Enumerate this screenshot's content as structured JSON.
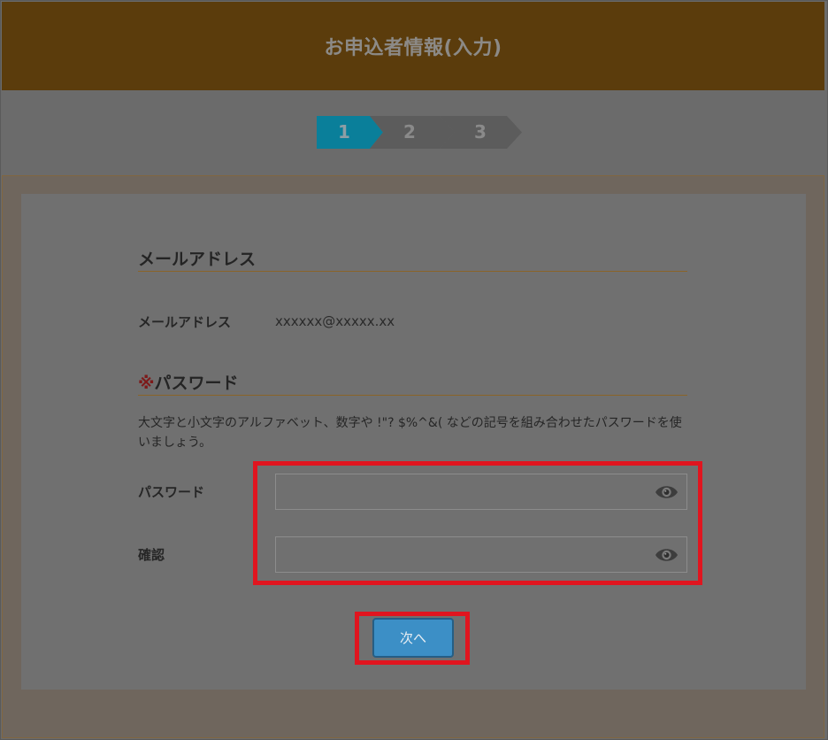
{
  "header": {
    "title": "お申込者情報(入力)"
  },
  "steps": [
    {
      "label": "1",
      "active": true
    },
    {
      "label": "2",
      "active": false
    },
    {
      "label": "3",
      "active": false
    }
  ],
  "colors": {
    "header_bg": "#5b3c0c",
    "step_active": "#0a7f9a",
    "step_inactive": "#5c5c5c",
    "section_rule": "#8a6428",
    "highlight": "#e0151f",
    "button": "#3c8fc6"
  },
  "email_section": {
    "title": "メールアドレス",
    "label": "メールアドレス",
    "value": "xxxxxx@xxxxx.xx"
  },
  "password_section": {
    "required_mark": "※",
    "title": "パスワード",
    "description": "大文字と小文字のアルファベット、数字や !\"? $%^&( などの記号を組み合わせたパスワードを使いましょう。",
    "password_label": "パスワード",
    "password_value": "",
    "confirm_label": "確認",
    "confirm_value": "",
    "toggle_icon": "eye-icon"
  },
  "actions": {
    "next_label": "次へ"
  }
}
